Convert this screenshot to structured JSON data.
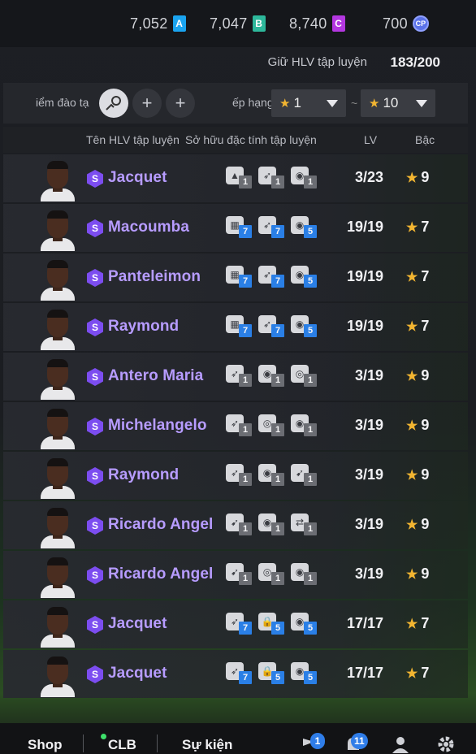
{
  "currencies": [
    {
      "value": "7,052",
      "tag": "A",
      "color": "#1aa4f0"
    },
    {
      "value": "7,047",
      "tag": "B",
      "color": "#2db89b"
    },
    {
      "value": "8,740",
      "tag": "C",
      "color": "#b337e0"
    },
    {
      "value": "700",
      "tag": "CP",
      "color": "#5b72e8"
    }
  ],
  "header": {
    "label": "Giữ HLV tập luyện",
    "count": "183/200"
  },
  "filter": {
    "training_label": "iểm đào tạ",
    "add1": "+",
    "add2": "+",
    "rank_label": "ếp hạng",
    "min_value": "1",
    "max_value": "10",
    "tilde": "~"
  },
  "columns": {
    "name": "Tên HLV tập luyện",
    "traits": "Sở hữu đặc tính tập luyện",
    "lv": "LV",
    "grade": "Bậc"
  },
  "coaches": [
    {
      "name": "Jacquet",
      "traits": [
        {
          "icon": "cone",
          "level": "1"
        },
        {
          "icon": "kick",
          "level": "1"
        },
        {
          "icon": "ball",
          "level": "1"
        }
      ],
      "lv": "3/23",
      "grade": "9"
    },
    {
      "name": "Macoumba",
      "traits": [
        {
          "icon": "goal",
          "level": "7"
        },
        {
          "icon": "kick",
          "level": "7"
        },
        {
          "icon": "ball",
          "level": "5"
        }
      ],
      "lv": "19/19",
      "grade": "7"
    },
    {
      "name": "Panteleimon",
      "traits": [
        {
          "icon": "goal",
          "level": "7"
        },
        {
          "icon": "kick",
          "level": "7"
        },
        {
          "icon": "ball",
          "level": "5"
        }
      ],
      "lv": "19/19",
      "grade": "7"
    },
    {
      "name": "Raymond",
      "traits": [
        {
          "icon": "goal",
          "level": "7"
        },
        {
          "icon": "kick",
          "level": "7"
        },
        {
          "icon": "ball",
          "level": "5"
        }
      ],
      "lv": "19/19",
      "grade": "7"
    },
    {
      "name": "Antero Maria",
      "traits": [
        {
          "icon": "kick",
          "level": "1"
        },
        {
          "icon": "ball",
          "level": "1"
        },
        {
          "icon": "target",
          "level": "1"
        }
      ],
      "lv": "3/19",
      "grade": "9"
    },
    {
      "name": "Michelangelo",
      "traits": [
        {
          "icon": "kick",
          "level": "1"
        },
        {
          "icon": "target",
          "level": "1"
        },
        {
          "icon": "ball",
          "level": "1"
        }
      ],
      "lv": "3/19",
      "grade": "9"
    },
    {
      "name": "Raymond",
      "traits": [
        {
          "icon": "kick",
          "level": "1"
        },
        {
          "icon": "ball",
          "level": "1"
        },
        {
          "icon": "run",
          "level": "1"
        }
      ],
      "lv": "3/19",
      "grade": "9"
    },
    {
      "name": "Ricardo Angel",
      "traits": [
        {
          "icon": "run",
          "level": "1"
        },
        {
          "icon": "ball",
          "level": "1"
        },
        {
          "icon": "pass",
          "level": "1"
        }
      ],
      "lv": "3/19",
      "grade": "9"
    },
    {
      "name": "Ricardo Angel",
      "traits": [
        {
          "icon": "run",
          "level": "1"
        },
        {
          "icon": "target",
          "level": "1"
        },
        {
          "icon": "ball",
          "level": "1"
        }
      ],
      "lv": "3/19",
      "grade": "9"
    },
    {
      "name": "Jacquet",
      "traits": [
        {
          "icon": "kick",
          "level": "7"
        },
        {
          "icon": "lock",
          "level": "5"
        },
        {
          "icon": "ball",
          "level": "5"
        }
      ],
      "lv": "17/17",
      "grade": "7"
    },
    {
      "name": "Jacquet",
      "traits": [
        {
          "icon": "kick",
          "level": "7"
        },
        {
          "icon": "lock",
          "level": "5"
        },
        {
          "icon": "ball",
          "level": "5"
        }
      ],
      "lv": "17/17",
      "grade": "7"
    }
  ],
  "nav": {
    "shop": "Shop",
    "clb": "CLB",
    "events": "Sự kiện",
    "badge1": "1",
    "badge2": "11"
  }
}
